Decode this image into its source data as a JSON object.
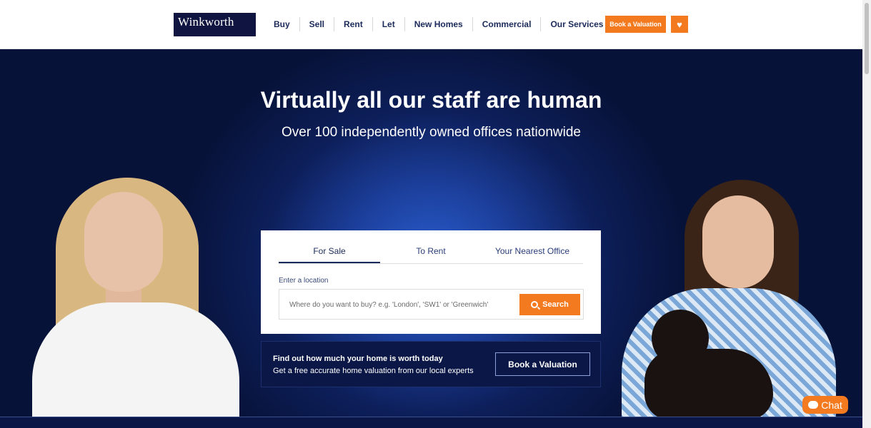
{
  "header": {
    "logo": "Winkworth",
    "nav": [
      "Buy",
      "Sell",
      "Rent",
      "Let",
      "New Homes",
      "Commercial",
      "Our Services"
    ],
    "book_valuation": "Book a Valuation",
    "favourite_icon": "heart-icon"
  },
  "hero": {
    "title": "Virtually all our staff are human",
    "subtitle": "Over 100 independently owned offices nationwide"
  },
  "search": {
    "tabs": [
      "For Sale",
      "To Rent",
      "Your Nearest Office"
    ],
    "active_tab": "For Sale",
    "location_label": "Enter a location",
    "placeholder": "Where do you want to buy? e.g. 'London', 'SW1' or 'Greenwich'",
    "button": "Search"
  },
  "valuation": {
    "title": "Find out how much your home is worth today",
    "subtitle": "Get a free accurate home valuation from our local experts",
    "button": "Book a Valuation"
  },
  "chat": {
    "label": "Chat"
  },
  "colors": {
    "accent": "#f47a20",
    "navy": "#0f1440"
  }
}
